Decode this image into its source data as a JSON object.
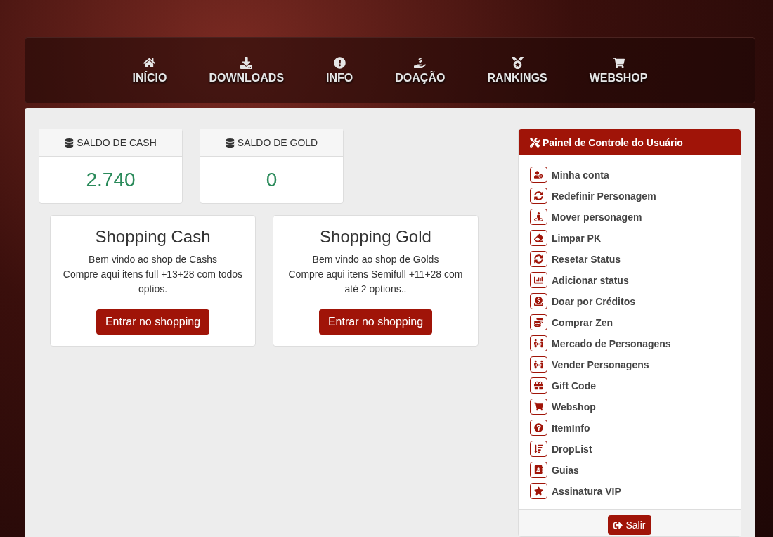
{
  "nav": [
    {
      "label": "INÍCIO"
    },
    {
      "label": "DOWNLOADS"
    },
    {
      "label": "INFO"
    },
    {
      "label": "DOAÇÃO"
    },
    {
      "label": "RANKINGS"
    },
    {
      "label": "WEBSHOP"
    }
  ],
  "balances": [
    {
      "label": "SALDO DE CASH",
      "value": "2.740"
    },
    {
      "label": "SALDO DE GOLD",
      "value": "0"
    }
  ],
  "shops": [
    {
      "title": "Shopping Cash",
      "lines": [
        "Bem vindo ao shop de Cashs",
        "Compre aqui itens full +13+28 com todos optios."
      ],
      "button": "Entrar no shopping"
    },
    {
      "title": "Shopping Gold",
      "lines": [
        "Bem vindo ao shop de Golds",
        "Compre aqui itens Semifull +11+28 com até 2 options.."
      ],
      "button": "Entrar no shopping"
    }
  ],
  "panel": {
    "title": "Painel de Controle do Usuário",
    "items": [
      "Minha conta",
      "Redefinir Personagem",
      "Mover personagem",
      "Limpar PK",
      "Resetar Status",
      "Adicionar status",
      "Doar por Créditos",
      "Comprar Zen",
      "Mercado de Personagens",
      "Vender Personagens",
      "Gift Code",
      "Webshop",
      "ItemInfo",
      "DropList",
      "Guias",
      "Assinatura VIP"
    ],
    "logout": "Salir"
  }
}
